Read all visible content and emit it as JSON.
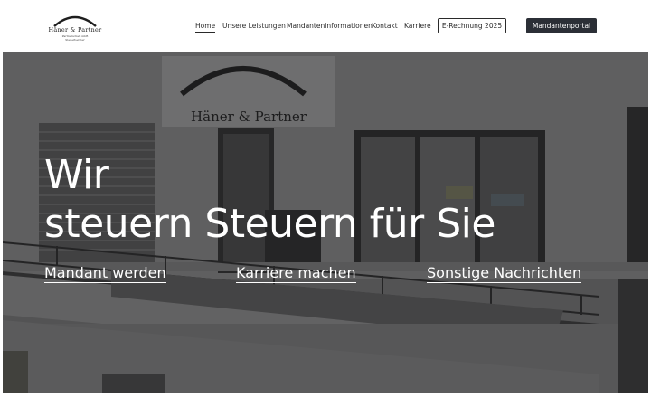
{
  "brand": {
    "name": "Häner & Partner",
    "sub1": "Partnerschaft mbB",
    "sub2": "Steuerberater"
  },
  "nav": {
    "items": [
      {
        "label": "Home",
        "active": true
      },
      {
        "label": "Unsere Leistungen",
        "active": false
      },
      {
        "label": "Mandanteninformationen",
        "active": false
      },
      {
        "label": "Kontakt",
        "active": false
      },
      {
        "label": "Karriere",
        "active": false
      }
    ],
    "erechnung_label": "E-Rechnung 2025",
    "portal_label": "Mandantenportal"
  },
  "hero": {
    "sign_text": "Häner & Partner",
    "headline_line1": "Wir",
    "headline_line2": "steuern Steuern für Sie",
    "links": [
      {
        "label": "Mandant werden"
      },
      {
        "label": "Karriere machen"
      },
      {
        "label": "Sonstige Nachrichten"
      }
    ]
  },
  "colors": {
    "dark_button": "#2b2f36",
    "text": "#2a2a2a",
    "hero_text": "#ffffff"
  }
}
